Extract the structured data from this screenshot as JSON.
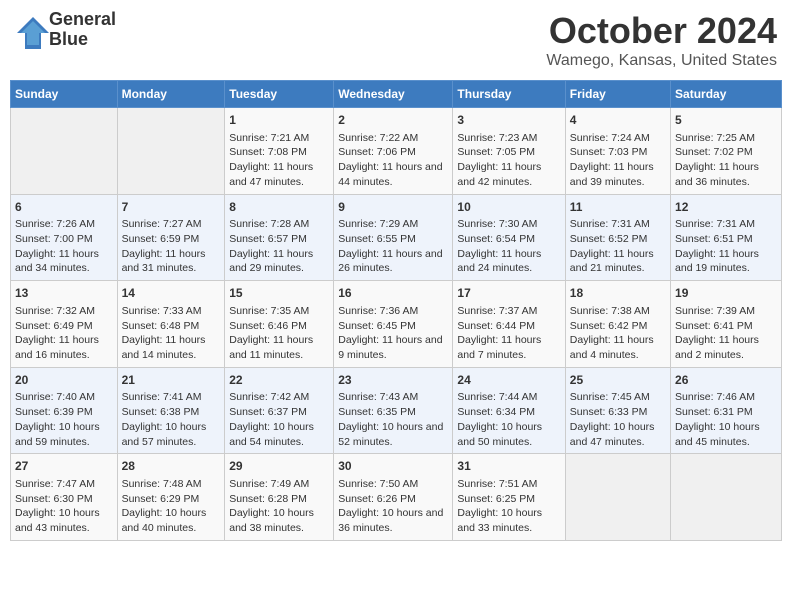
{
  "header": {
    "logo_line1": "General",
    "logo_line2": "Blue",
    "title": "October 2024",
    "subtitle": "Wamego, Kansas, United States"
  },
  "weekdays": [
    "Sunday",
    "Monday",
    "Tuesday",
    "Wednesday",
    "Thursday",
    "Friday",
    "Saturday"
  ],
  "weeks": [
    [
      {
        "day": "",
        "info": ""
      },
      {
        "day": "",
        "info": ""
      },
      {
        "day": "1",
        "info": "Sunrise: 7:21 AM\nSunset: 7:08 PM\nDaylight: 11 hours and 47 minutes."
      },
      {
        "day": "2",
        "info": "Sunrise: 7:22 AM\nSunset: 7:06 PM\nDaylight: 11 hours and 44 minutes."
      },
      {
        "day": "3",
        "info": "Sunrise: 7:23 AM\nSunset: 7:05 PM\nDaylight: 11 hours and 42 minutes."
      },
      {
        "day": "4",
        "info": "Sunrise: 7:24 AM\nSunset: 7:03 PM\nDaylight: 11 hours and 39 minutes."
      },
      {
        "day": "5",
        "info": "Sunrise: 7:25 AM\nSunset: 7:02 PM\nDaylight: 11 hours and 36 minutes."
      }
    ],
    [
      {
        "day": "6",
        "info": "Sunrise: 7:26 AM\nSunset: 7:00 PM\nDaylight: 11 hours and 34 minutes."
      },
      {
        "day": "7",
        "info": "Sunrise: 7:27 AM\nSunset: 6:59 PM\nDaylight: 11 hours and 31 minutes."
      },
      {
        "day": "8",
        "info": "Sunrise: 7:28 AM\nSunset: 6:57 PM\nDaylight: 11 hours and 29 minutes."
      },
      {
        "day": "9",
        "info": "Sunrise: 7:29 AM\nSunset: 6:55 PM\nDaylight: 11 hours and 26 minutes."
      },
      {
        "day": "10",
        "info": "Sunrise: 7:30 AM\nSunset: 6:54 PM\nDaylight: 11 hours and 24 minutes."
      },
      {
        "day": "11",
        "info": "Sunrise: 7:31 AM\nSunset: 6:52 PM\nDaylight: 11 hours and 21 minutes."
      },
      {
        "day": "12",
        "info": "Sunrise: 7:31 AM\nSunset: 6:51 PM\nDaylight: 11 hours and 19 minutes."
      }
    ],
    [
      {
        "day": "13",
        "info": "Sunrise: 7:32 AM\nSunset: 6:49 PM\nDaylight: 11 hours and 16 minutes."
      },
      {
        "day": "14",
        "info": "Sunrise: 7:33 AM\nSunset: 6:48 PM\nDaylight: 11 hours and 14 minutes."
      },
      {
        "day": "15",
        "info": "Sunrise: 7:35 AM\nSunset: 6:46 PM\nDaylight: 11 hours and 11 minutes."
      },
      {
        "day": "16",
        "info": "Sunrise: 7:36 AM\nSunset: 6:45 PM\nDaylight: 11 hours and 9 minutes."
      },
      {
        "day": "17",
        "info": "Sunrise: 7:37 AM\nSunset: 6:44 PM\nDaylight: 11 hours and 7 minutes."
      },
      {
        "day": "18",
        "info": "Sunrise: 7:38 AM\nSunset: 6:42 PM\nDaylight: 11 hours and 4 minutes."
      },
      {
        "day": "19",
        "info": "Sunrise: 7:39 AM\nSunset: 6:41 PM\nDaylight: 11 hours and 2 minutes."
      }
    ],
    [
      {
        "day": "20",
        "info": "Sunrise: 7:40 AM\nSunset: 6:39 PM\nDaylight: 10 hours and 59 minutes."
      },
      {
        "day": "21",
        "info": "Sunrise: 7:41 AM\nSunset: 6:38 PM\nDaylight: 10 hours and 57 minutes."
      },
      {
        "day": "22",
        "info": "Sunrise: 7:42 AM\nSunset: 6:37 PM\nDaylight: 10 hours and 54 minutes."
      },
      {
        "day": "23",
        "info": "Sunrise: 7:43 AM\nSunset: 6:35 PM\nDaylight: 10 hours and 52 minutes."
      },
      {
        "day": "24",
        "info": "Sunrise: 7:44 AM\nSunset: 6:34 PM\nDaylight: 10 hours and 50 minutes."
      },
      {
        "day": "25",
        "info": "Sunrise: 7:45 AM\nSunset: 6:33 PM\nDaylight: 10 hours and 47 minutes."
      },
      {
        "day": "26",
        "info": "Sunrise: 7:46 AM\nSunset: 6:31 PM\nDaylight: 10 hours and 45 minutes."
      }
    ],
    [
      {
        "day": "27",
        "info": "Sunrise: 7:47 AM\nSunset: 6:30 PM\nDaylight: 10 hours and 43 minutes."
      },
      {
        "day": "28",
        "info": "Sunrise: 7:48 AM\nSunset: 6:29 PM\nDaylight: 10 hours and 40 minutes."
      },
      {
        "day": "29",
        "info": "Sunrise: 7:49 AM\nSunset: 6:28 PM\nDaylight: 10 hours and 38 minutes."
      },
      {
        "day": "30",
        "info": "Sunrise: 7:50 AM\nSunset: 6:26 PM\nDaylight: 10 hours and 36 minutes."
      },
      {
        "day": "31",
        "info": "Sunrise: 7:51 AM\nSunset: 6:25 PM\nDaylight: 10 hours and 33 minutes."
      },
      {
        "day": "",
        "info": ""
      },
      {
        "day": "",
        "info": ""
      }
    ]
  ]
}
